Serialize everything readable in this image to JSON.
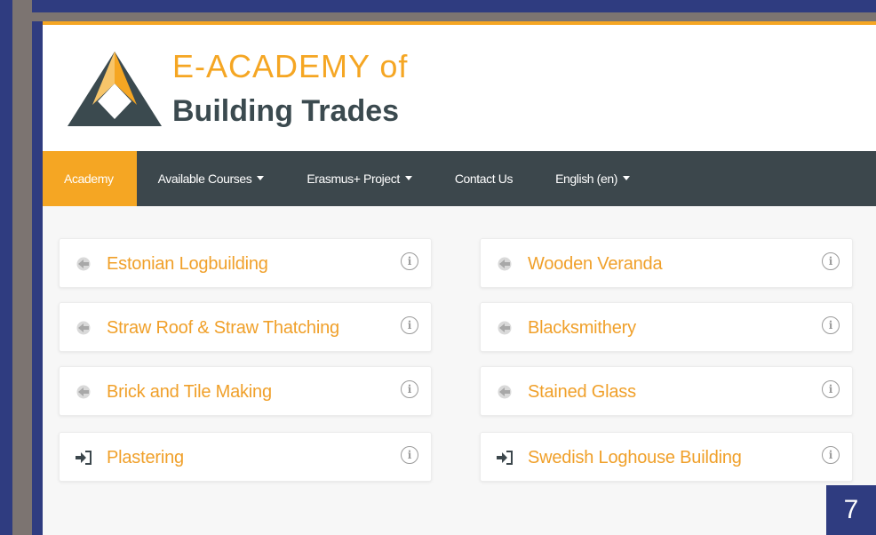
{
  "brand": {
    "line1": "E-ACADEMY of",
    "line2": "Building Trades",
    "accent_color": "#f5a623",
    "dark_color": "#3b4a4f"
  },
  "nav": {
    "items": [
      {
        "label": "Academy",
        "active": true,
        "dropdown": false
      },
      {
        "label": "Available Courses",
        "active": false,
        "dropdown": true
      },
      {
        "label": "Erasmus+ Project",
        "active": false,
        "dropdown": true
      },
      {
        "label": "Contact Us",
        "active": false,
        "dropdown": false
      },
      {
        "label": "English (en)",
        "active": false,
        "dropdown": true
      }
    ]
  },
  "courses": [
    {
      "title": "Estonian Logbuilding",
      "icon": "guest-enter-icon"
    },
    {
      "title": "Wooden Veranda",
      "icon": "guest-enter-icon"
    },
    {
      "title": "Straw Roof & Straw Thatching",
      "icon": "guest-enter-icon"
    },
    {
      "title": "Blacksmithery",
      "icon": "guest-enter-icon"
    },
    {
      "title": "Brick and Tile Making",
      "icon": "guest-enter-icon"
    },
    {
      "title": "Stained Glass",
      "icon": "guest-enter-icon"
    },
    {
      "title": "Plastering",
      "icon": "enrol-sign-in-icon"
    },
    {
      "title": "Swedish Loghouse Building",
      "icon": "enrol-sign-in-icon"
    }
  ],
  "info_glyph": "i",
  "slide_number": "7"
}
